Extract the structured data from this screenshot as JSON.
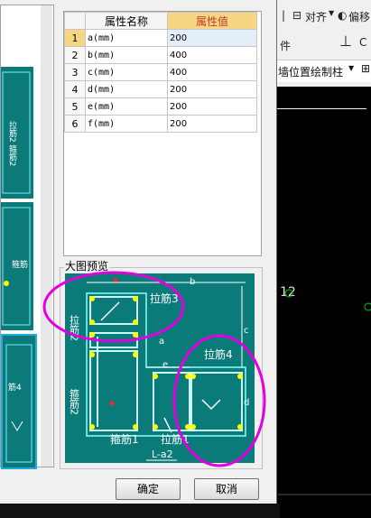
{
  "table": {
    "header_name": "属性名称",
    "header_value": "属性值",
    "rows": [
      {
        "idx": "1",
        "name": "a(mm)",
        "value": "200"
      },
      {
        "idx": "2",
        "name": "b(mm)",
        "value": "400"
      },
      {
        "idx": "3",
        "name": "c(mm)",
        "value": "400"
      },
      {
        "idx": "4",
        "name": "d(mm)",
        "value": "200"
      },
      {
        "idx": "5",
        "name": "e(mm)",
        "value": "200"
      },
      {
        "idx": "6",
        "name": "f(mm)",
        "value": "200"
      }
    ]
  },
  "preview": {
    "label": "大图预览",
    "ann_lajin3": "拉筋3",
    "ann_lajin2": "拉筋2",
    "ann_lajin4": "拉筋4",
    "ann_gujin2": "箍筋2",
    "ann_gujin1": "箍筋1",
    "ann_lajin1": "拉筋1",
    "caption": "L-a2",
    "dim_b": "b",
    "dim_c": "c",
    "dim_e": "e",
    "dim_d": "d",
    "dim_a": "a"
  },
  "left_thumbs": {
    "t1_text": "拉筋2 箍筋2",
    "t2_text": "箍筋",
    "t3_text": "筋4"
  },
  "buttons": {
    "ok": "确定",
    "cancel": "取消"
  },
  "app": {
    "align_label": "对齐",
    "offset_label": "偏移",
    "tab_part": "件",
    "draw_col_label": "墙位置绘制柱",
    "number_12": "12"
  },
  "colors": {
    "accent": "#f6d682",
    "teal": "#0a7b79",
    "ellipse": "#e000e0"
  }
}
